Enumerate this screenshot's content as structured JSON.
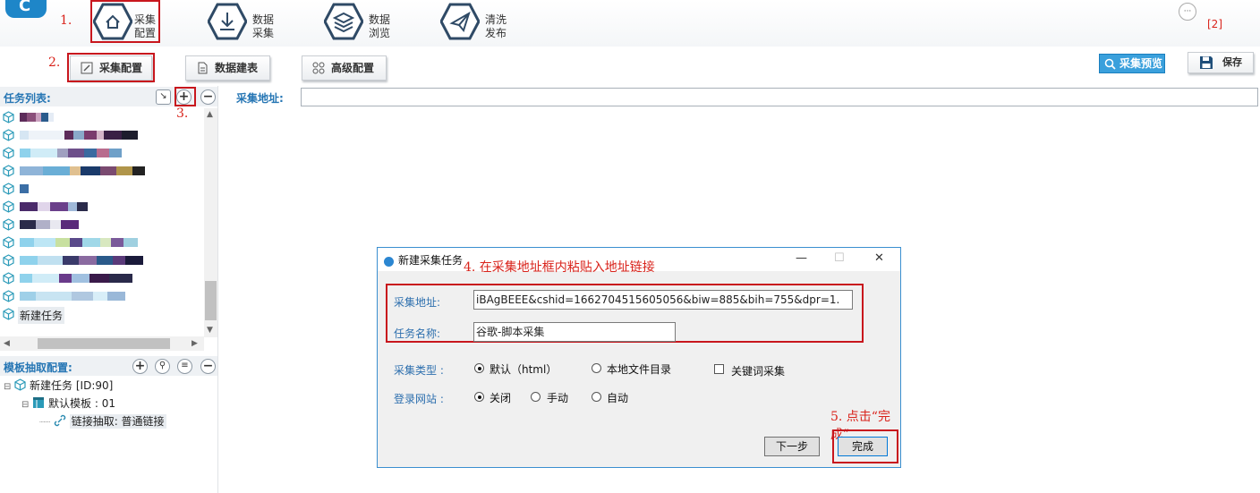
{
  "nav": {
    "items": [
      {
        "icon": "home-icon",
        "line1": "采集",
        "line2": "配置"
      },
      {
        "icon": "download-icon",
        "line1": "数据",
        "line2": "采集"
      },
      {
        "icon": "layers-icon",
        "line1": "数据",
        "line2": "浏览"
      },
      {
        "icon": "send-icon",
        "line1": "清洗",
        "line2": "发布"
      }
    ],
    "message_count": "[2]"
  },
  "steps": {
    "s1": "1.",
    "s2": "2.",
    "s3": "3.",
    "s4": "4. 在采集地址框内粘贴入地址链接",
    "s5": "5. 点击“完成”"
  },
  "toolbar": {
    "tab_collect_config": "采集配置",
    "tab_data_table": "数据建表",
    "tab_advanced_config": "高级配置",
    "preview_label": "采集预览",
    "save_label": "保存"
  },
  "task_panel": {
    "title": "任务列表:",
    "new_task_label": "新建任务"
  },
  "template_panel": {
    "title": "模板抽取配置:",
    "tree": {
      "root": "新建任务 [ID:90]",
      "template": "默认模板 : 01",
      "link": "链接抽取: 普通链接"
    }
  },
  "main": {
    "address_label": "采集地址:"
  },
  "dialog": {
    "title": "新建采集任务",
    "address_label": "采集地址:",
    "address_value": "iBAgBEEE&cshid=1662704515605056&biw=885&bih=755&dpr=1.",
    "name_label": "任务名称:",
    "name_value": "谷歌-脚本采集",
    "type_label": "采集类型 :",
    "type_options": [
      "默认（html）",
      "本地文件目录"
    ],
    "keyword_option": "关键词采集",
    "login_label": "登录网站 :",
    "login_options": [
      "关闭",
      "手动",
      "自动"
    ],
    "next_button": "下一步",
    "finish_button": "完成"
  },
  "colors": {
    "accent_blue": "#2676b4",
    "annotation_red": "#c8161d",
    "dialog_border": "#3a8fd0"
  }
}
